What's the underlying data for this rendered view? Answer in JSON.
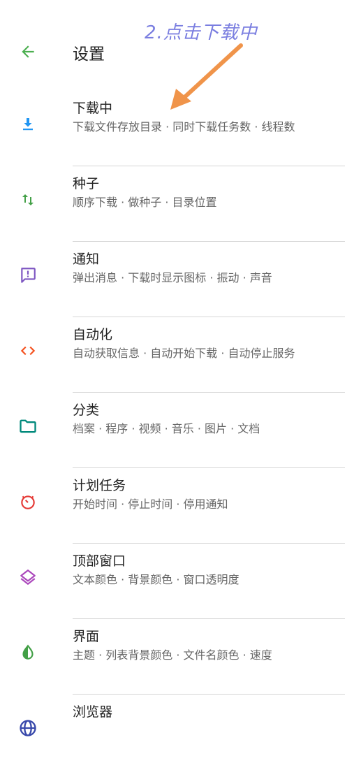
{
  "header": {
    "title": "设置",
    "annotation": "2.点击下载中"
  },
  "colors": {
    "back": "#4caf50",
    "arrow": "#f0944a",
    "annotation": "#7a7ee0"
  },
  "items": [
    {
      "label": "下载中",
      "sub": "下载文件存放目录 · 同时下载任务数 · 线程数",
      "icon": "download-icon",
      "color": "#2196f3"
    },
    {
      "label": "种子",
      "sub": "顺序下载 · 做种子 · 目录位置",
      "icon": "sort-arrows-icon",
      "color": "#43a047"
    },
    {
      "label": "通知",
      "sub": "弹出消息 · 下载时显示图标 · 振动 · 声音",
      "icon": "notification-icon",
      "color": "#7e57c2"
    },
    {
      "label": "自动化",
      "sub": "自动获取信息 · 自动开始下载 · 自动停止服务",
      "icon": "code-icon",
      "color": "#f4511e"
    },
    {
      "label": "分类",
      "sub": "档案 · 程序 · 视频 · 音乐 · 图片 · 文档",
      "icon": "folder-icon",
      "color": "#00897b"
    },
    {
      "label": "计划任务",
      "sub": "开始时间 · 停止时间 · 停用通知",
      "icon": "timer-icon",
      "color": "#e53935"
    },
    {
      "label": "顶部窗口",
      "sub": "文本颜色 · 背景颜色 · 窗口透明度",
      "icon": "layers-icon",
      "color": "#ab47bc"
    },
    {
      "label": "界面",
      "sub": "主题 · 列表背景颜色 · 文件名颜色 · 速度",
      "icon": "contrast-icon",
      "color": "#43a047"
    },
    {
      "label": "浏览器",
      "sub": "",
      "icon": "globe-icon",
      "color": "#3949ab"
    }
  ]
}
